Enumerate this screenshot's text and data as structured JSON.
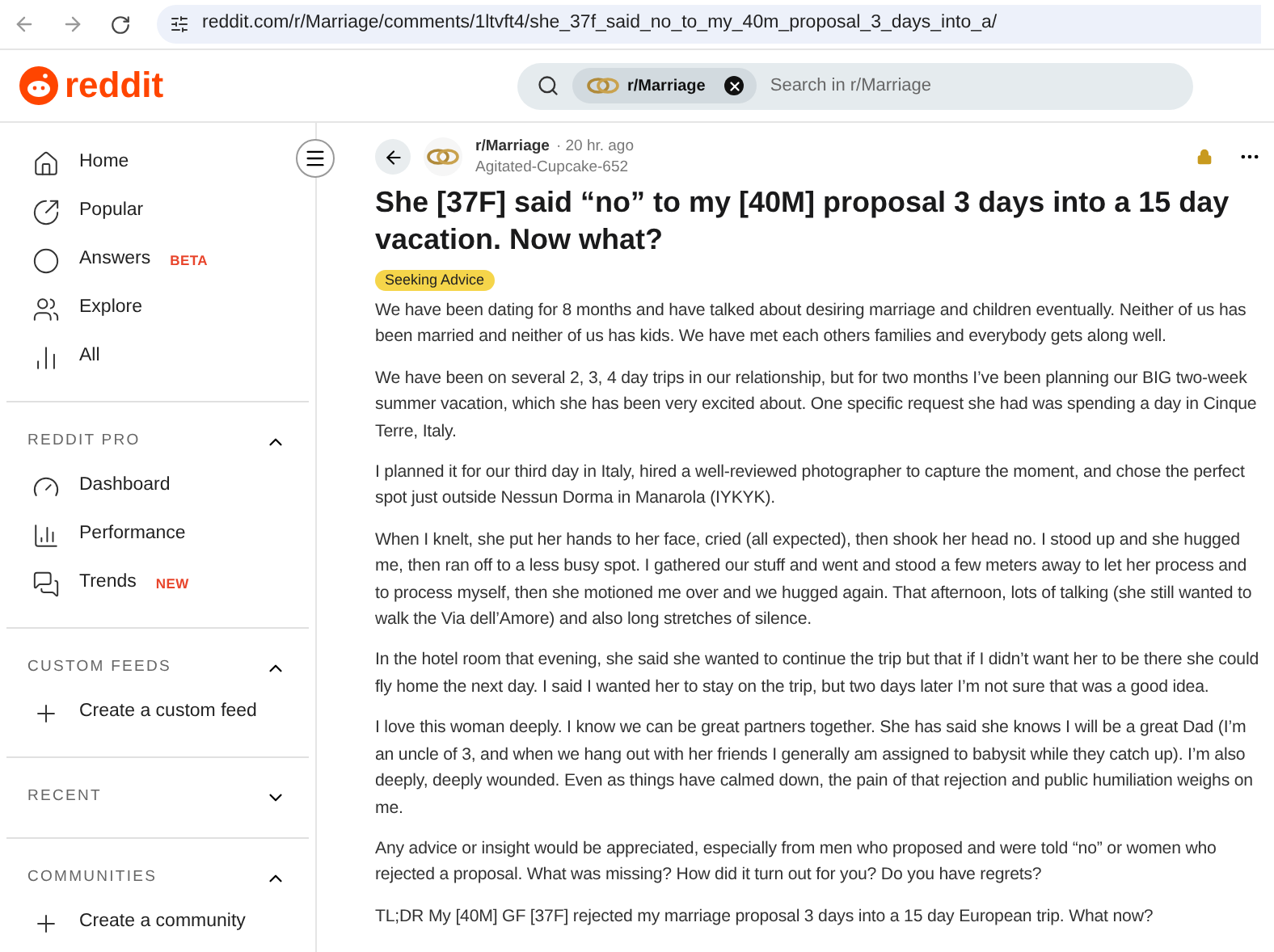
{
  "browser": {
    "url": "reddit.com/r/Marriage/comments/1ltvft4/she_37f_said_no_to_my_40m_proposal_3_days_into_a/"
  },
  "header": {
    "logo_text": "reddit",
    "search_chip": "r/Marriage",
    "search_placeholder": "Search in r/Marriage"
  },
  "sidebar": {
    "items": [
      {
        "kind": "home",
        "label": "Home"
      },
      {
        "kind": "popular",
        "label": "Popular"
      },
      {
        "kind": "answers",
        "label": "Answers",
        "badge": "BETA"
      },
      {
        "kind": "explore",
        "label": "Explore"
      },
      {
        "kind": "all",
        "label": "All"
      }
    ],
    "sections": [
      {
        "title": "REDDIT PRO",
        "expanded": true,
        "items": [
          {
            "kind": "dashboard",
            "label": "Dashboard"
          },
          {
            "kind": "performance",
            "label": "Performance"
          },
          {
            "kind": "trends",
            "label": "Trends",
            "badge": "NEW"
          }
        ]
      },
      {
        "title": "CUSTOM FEEDS",
        "expanded": true,
        "items": [
          {
            "kind": "create",
            "label": "Create a custom feed"
          }
        ]
      },
      {
        "title": "RECENT",
        "expanded": false
      },
      {
        "title": "COMMUNITIES",
        "expanded": true,
        "items": [
          {
            "kind": "create",
            "label": "Create a community"
          }
        ]
      }
    ]
  },
  "post": {
    "subreddit": "r/Marriage",
    "separator": "·",
    "time": "20 hr. ago",
    "author": "Agitated-Cupcake-652",
    "title": "She [37F] said “no” to my [40M] proposal 3 days into a 15 day vacation. Now what?",
    "flair": "Seeking Advice",
    "paragraphs": [
      "We have been dating for 8 months and have talked about desiring marriage and children eventually. Neither of us has been married and neither of us has kids. We have met each others families and everybody gets along well.",
      "We have been on several 2, 3, 4 day trips in our relationship, but for two months I’ve been planning our BIG two-week summer vacation, which she has been very excited about. One specific request she had was spending a day in Cinque Terre, Italy.",
      "I planned it for our third day in Italy, hired a well-reviewed photographer to capture the moment, and chose the perfect spot just outside Nessun Dorma in Manarola (IYKYK).",
      "When I knelt, she put her hands to her face, cried (all expected), then shook her head no. I stood up and she hugged me, then ran off to a less busy spot. I gathered our stuff and went and stood a few meters away to let her process and to process myself, then she motioned me over and we hugged again. That afternoon, lots of talking (she still wanted to walk the Via dell’Amore) and also long stretches of silence.",
      "In the hotel room that evening, she said she wanted to continue the trip but that if I didn’t want her to be there she could fly home the next day. I said I wanted her to stay on the trip, but two days later I’m not sure that was a good idea.",
      "I love this woman deeply. I know we can be great partners together. She has said she knows I will be a great Dad (I’m an uncle of 3, and when we hang out with her friends I generally am assigned to babysit while they catch up). I’m also deeply, deeply wounded. Even as things have calmed down, the pain of that rejection and public humiliation weighs on me.",
      "Any advice or insight would be appreciated, especially from men who proposed and were told “no” or women who rejected a proposal. What was missing? How did it turn out for you? Do you have regrets?",
      "TL;DR My [40M] GF [37F] rejected my marriage proposal 3 days into a 15 day European trip. What now?"
    ]
  }
}
